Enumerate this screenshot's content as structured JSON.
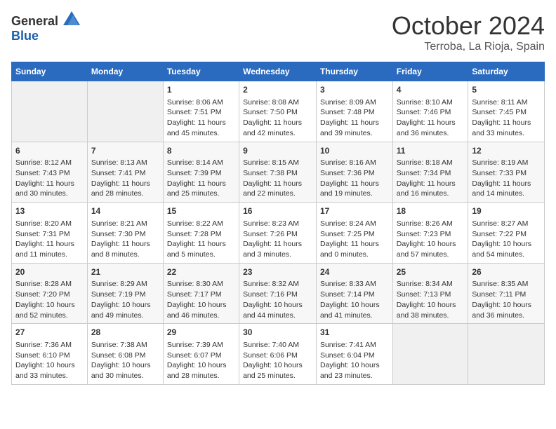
{
  "header": {
    "logo_general": "General",
    "logo_blue": "Blue",
    "month": "October 2024",
    "location": "Terroba, La Rioja, Spain"
  },
  "weekdays": [
    "Sunday",
    "Monday",
    "Tuesday",
    "Wednesday",
    "Thursday",
    "Friday",
    "Saturday"
  ],
  "weeks": [
    [
      {
        "day": "",
        "sunrise": "",
        "sunset": "",
        "daylight": "",
        "empty": true
      },
      {
        "day": "",
        "sunrise": "",
        "sunset": "",
        "daylight": "",
        "empty": true
      },
      {
        "day": "1",
        "sunrise": "Sunrise: 8:06 AM",
        "sunset": "Sunset: 7:51 PM",
        "daylight": "Daylight: 11 hours and 45 minutes."
      },
      {
        "day": "2",
        "sunrise": "Sunrise: 8:08 AM",
        "sunset": "Sunset: 7:50 PM",
        "daylight": "Daylight: 11 hours and 42 minutes."
      },
      {
        "day": "3",
        "sunrise": "Sunrise: 8:09 AM",
        "sunset": "Sunset: 7:48 PM",
        "daylight": "Daylight: 11 hours and 39 minutes."
      },
      {
        "day": "4",
        "sunrise": "Sunrise: 8:10 AM",
        "sunset": "Sunset: 7:46 PM",
        "daylight": "Daylight: 11 hours and 36 minutes."
      },
      {
        "day": "5",
        "sunrise": "Sunrise: 8:11 AM",
        "sunset": "Sunset: 7:45 PM",
        "daylight": "Daylight: 11 hours and 33 minutes."
      }
    ],
    [
      {
        "day": "6",
        "sunrise": "Sunrise: 8:12 AM",
        "sunset": "Sunset: 7:43 PM",
        "daylight": "Daylight: 11 hours and 30 minutes."
      },
      {
        "day": "7",
        "sunrise": "Sunrise: 8:13 AM",
        "sunset": "Sunset: 7:41 PM",
        "daylight": "Daylight: 11 hours and 28 minutes."
      },
      {
        "day": "8",
        "sunrise": "Sunrise: 8:14 AM",
        "sunset": "Sunset: 7:39 PM",
        "daylight": "Daylight: 11 hours and 25 minutes."
      },
      {
        "day": "9",
        "sunrise": "Sunrise: 8:15 AM",
        "sunset": "Sunset: 7:38 PM",
        "daylight": "Daylight: 11 hours and 22 minutes."
      },
      {
        "day": "10",
        "sunrise": "Sunrise: 8:16 AM",
        "sunset": "Sunset: 7:36 PM",
        "daylight": "Daylight: 11 hours and 19 minutes."
      },
      {
        "day": "11",
        "sunrise": "Sunrise: 8:18 AM",
        "sunset": "Sunset: 7:34 PM",
        "daylight": "Daylight: 11 hours and 16 minutes."
      },
      {
        "day": "12",
        "sunrise": "Sunrise: 8:19 AM",
        "sunset": "Sunset: 7:33 PM",
        "daylight": "Daylight: 11 hours and 14 minutes."
      }
    ],
    [
      {
        "day": "13",
        "sunrise": "Sunrise: 8:20 AM",
        "sunset": "Sunset: 7:31 PM",
        "daylight": "Daylight: 11 hours and 11 minutes."
      },
      {
        "day": "14",
        "sunrise": "Sunrise: 8:21 AM",
        "sunset": "Sunset: 7:30 PM",
        "daylight": "Daylight: 11 hours and 8 minutes."
      },
      {
        "day": "15",
        "sunrise": "Sunrise: 8:22 AM",
        "sunset": "Sunset: 7:28 PM",
        "daylight": "Daylight: 11 hours and 5 minutes."
      },
      {
        "day": "16",
        "sunrise": "Sunrise: 8:23 AM",
        "sunset": "Sunset: 7:26 PM",
        "daylight": "Daylight: 11 hours and 3 minutes."
      },
      {
        "day": "17",
        "sunrise": "Sunrise: 8:24 AM",
        "sunset": "Sunset: 7:25 PM",
        "daylight": "Daylight: 11 hours and 0 minutes."
      },
      {
        "day": "18",
        "sunrise": "Sunrise: 8:26 AM",
        "sunset": "Sunset: 7:23 PM",
        "daylight": "Daylight: 10 hours and 57 minutes."
      },
      {
        "day": "19",
        "sunrise": "Sunrise: 8:27 AM",
        "sunset": "Sunset: 7:22 PM",
        "daylight": "Daylight: 10 hours and 54 minutes."
      }
    ],
    [
      {
        "day": "20",
        "sunrise": "Sunrise: 8:28 AM",
        "sunset": "Sunset: 7:20 PM",
        "daylight": "Daylight: 10 hours and 52 minutes."
      },
      {
        "day": "21",
        "sunrise": "Sunrise: 8:29 AM",
        "sunset": "Sunset: 7:19 PM",
        "daylight": "Daylight: 10 hours and 49 minutes."
      },
      {
        "day": "22",
        "sunrise": "Sunrise: 8:30 AM",
        "sunset": "Sunset: 7:17 PM",
        "daylight": "Daylight: 10 hours and 46 minutes."
      },
      {
        "day": "23",
        "sunrise": "Sunrise: 8:32 AM",
        "sunset": "Sunset: 7:16 PM",
        "daylight": "Daylight: 10 hours and 44 minutes."
      },
      {
        "day": "24",
        "sunrise": "Sunrise: 8:33 AM",
        "sunset": "Sunset: 7:14 PM",
        "daylight": "Daylight: 10 hours and 41 minutes."
      },
      {
        "day": "25",
        "sunrise": "Sunrise: 8:34 AM",
        "sunset": "Sunset: 7:13 PM",
        "daylight": "Daylight: 10 hours and 38 minutes."
      },
      {
        "day": "26",
        "sunrise": "Sunrise: 8:35 AM",
        "sunset": "Sunset: 7:11 PM",
        "daylight": "Daylight: 10 hours and 36 minutes."
      }
    ],
    [
      {
        "day": "27",
        "sunrise": "Sunrise: 7:36 AM",
        "sunset": "Sunset: 6:10 PM",
        "daylight": "Daylight: 10 hours and 33 minutes."
      },
      {
        "day": "28",
        "sunrise": "Sunrise: 7:38 AM",
        "sunset": "Sunset: 6:08 PM",
        "daylight": "Daylight: 10 hours and 30 minutes."
      },
      {
        "day": "29",
        "sunrise": "Sunrise: 7:39 AM",
        "sunset": "Sunset: 6:07 PM",
        "daylight": "Daylight: 10 hours and 28 minutes."
      },
      {
        "day": "30",
        "sunrise": "Sunrise: 7:40 AM",
        "sunset": "Sunset: 6:06 PM",
        "daylight": "Daylight: 10 hours and 25 minutes."
      },
      {
        "day": "31",
        "sunrise": "Sunrise: 7:41 AM",
        "sunset": "Sunset: 6:04 PM",
        "daylight": "Daylight: 10 hours and 23 minutes."
      },
      {
        "day": "",
        "sunrise": "",
        "sunset": "",
        "daylight": "",
        "empty": true
      },
      {
        "day": "",
        "sunrise": "",
        "sunset": "",
        "daylight": "",
        "empty": true
      }
    ]
  ]
}
